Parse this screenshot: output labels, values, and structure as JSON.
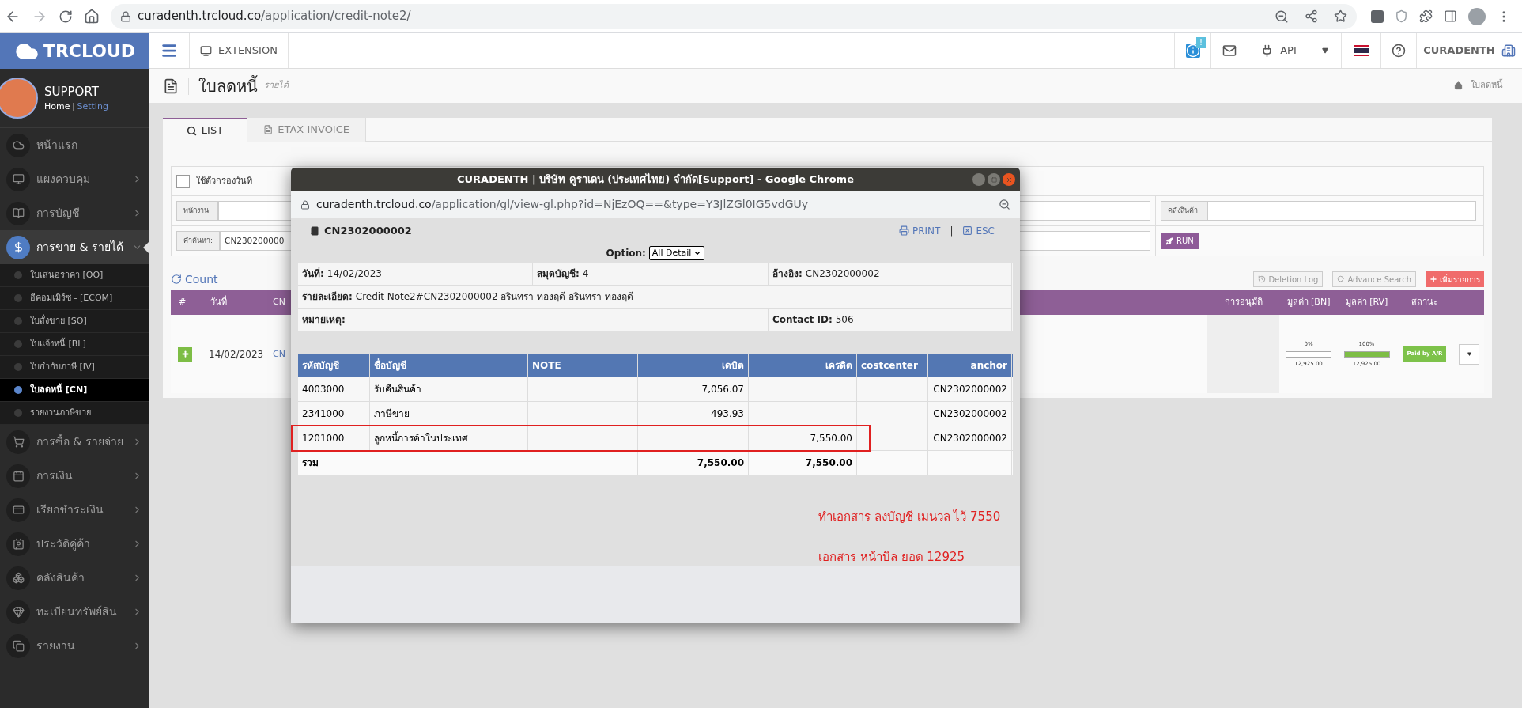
{
  "browser": {
    "url_host": "curadenth.trcloud.co",
    "url_path": "/application/credit-note2/"
  },
  "app_header": {
    "logo": "TRCLOUD",
    "extension": "EXTENSION",
    "notification_badge": "!",
    "api": "API",
    "company": "CURADENTH"
  },
  "user": {
    "name": "SUPPORT",
    "links": [
      "Home",
      "Setting"
    ]
  },
  "sidebar": {
    "items": [
      {
        "label": "หน้าแรก",
        "kind": "link",
        "selected": false
      },
      {
        "label": "แผงควบคุม",
        "kind": "group",
        "expanded": false,
        "selected": false
      },
      {
        "label": "การบัญชี",
        "kind": "group",
        "expanded": false,
        "selected": false
      },
      {
        "label": "การขาย & รายได้",
        "kind": "group",
        "expanded": true,
        "selected": true,
        "children": [
          {
            "label": "ใบเสนอราคา [QO]",
            "selected": false
          },
          {
            "label": "อีคอมเมิร์ซ - [ECOM]",
            "selected": false
          },
          {
            "label": "ใบสั่งขาย [SO]",
            "selected": false
          },
          {
            "label": "ใบแจ้งหนี้ [BL]",
            "selected": false
          },
          {
            "label": "ใบกำกับภาษี [IV]",
            "selected": false
          },
          {
            "label": "ใบลดหนี้ [CN]",
            "selected": true
          },
          {
            "label": "รายงานภาษีขาย",
            "selected": false
          }
        ]
      },
      {
        "label": "การซื้อ & รายจ่าย",
        "kind": "group",
        "expanded": false,
        "selected": false
      },
      {
        "label": "การเงิน",
        "kind": "group",
        "expanded": false,
        "selected": false
      },
      {
        "label": "เรียกชำระเงิน",
        "kind": "group",
        "expanded": false,
        "selected": false
      },
      {
        "label": "ประวัติคู่ค้า",
        "kind": "group",
        "expanded": false,
        "selected": false
      },
      {
        "label": "คลังสินค้า",
        "kind": "group",
        "expanded": false,
        "selected": false
      },
      {
        "label": "ทะเบียนทรัพย์สิน",
        "kind": "group",
        "expanded": false,
        "selected": false
      },
      {
        "label": "รายงาน",
        "kind": "group",
        "expanded": false,
        "selected": false
      }
    ]
  },
  "page": {
    "title": "ใบลดหนี้",
    "subtitle": "รายได้",
    "breadcrumb": "ใบลดหนี้"
  },
  "tabs": [
    {
      "label": "LIST",
      "selected": true
    },
    {
      "label": "ETAX INVOICE",
      "selected": false
    }
  ],
  "filters": {
    "date_filter": {
      "label": "ใช้ตัวกรองวันที่",
      "checked": false
    },
    "staff": {
      "label": "พนักงาน:"
    },
    "search": {
      "label": "คำค้นหา:",
      "value": "CN230200000"
    },
    "warehouse": {
      "label": "คลังสินค้า:"
    },
    "run": "RUN"
  },
  "list": {
    "count": "Count",
    "buttons": [
      "Deletion Log",
      "Advance Search",
      "เพิ่มรายการ"
    ],
    "columns_left": [
      "#",
      "วันที่",
      "CN"
    ],
    "columns_right": [
      "การอนุมัติ",
      "มูลค่า [BN]",
      "มูลค่า [RV]",
      "สถานะ"
    ],
    "rows": [
      {
        "date": "14/02/2023",
        "doc": "CN",
        "bn": {
          "percent": "0%",
          "level": 0,
          "amount": "12,925.00"
        },
        "rv": {
          "percent": "100%",
          "level": 1,
          "amount": "12,925.00"
        },
        "status": "Paid by A/R"
      }
    ]
  },
  "popup": {
    "title": "CURADENTH | บริษัท คูราเดน (ประเทศไทย) จำกัด[Support] - Google Chrome",
    "url_host": "curadenth.trcloud.co",
    "url_path": "/application/gl/view-gl.php?id=NjEzOQ==&type=Y3JlZGl0IG5vdGUy",
    "doc_no": "CN2302000002",
    "print": "PRINT",
    "separator": "|",
    "esc": "ESC",
    "option_label": "Option:",
    "option_value": "All Detail",
    "info": [
      [
        {
          "label": "วันที่:",
          "value": "14/02/2023"
        },
        {
          "label": "สมุดบัญชี:",
          "value": "4"
        },
        {
          "label": "อ้างอิง:",
          "value": "CN2302000002"
        }
      ],
      [
        {
          "label": "รายละเอียด:",
          "value": "Credit Note2#CN2302000002 อรินทรา ทองฤดี อรินทรา ทองฤดี"
        }
      ],
      [
        {
          "label": "หมายเหตุ:"
        },
        {
          "label": "Contact ID:",
          "value": "506"
        }
      ]
    ],
    "gl_table": {
      "columns": [
        "รหัสบัญชี",
        "ชื่อบัญชี",
        "NOTE",
        "เดบิต",
        "เครดิต",
        "costcenter",
        "anchor"
      ],
      "rows": [
        {
          "code": "4003000",
          "name": "รับคืนสินค้า",
          "debit": "7,056.07",
          "anchor": "CN2302000002",
          "highlighted": false
        },
        {
          "code": "2341000",
          "name": "ภาษีขาย",
          "debit": "493.93",
          "anchor": "CN2302000002",
          "highlighted": false
        },
        {
          "code": "1201000",
          "name": "ลูกหนี้การค้าในประเทศ",
          "credit": "7,550.00",
          "anchor": "CN2302000002",
          "highlighted": true
        }
      ],
      "total": {
        "label": "รวม",
        "debit": "7,550.00",
        "credit": "7,550.00"
      }
    },
    "annotations": [
      "ทำเอกสาร ลงบัญชี เมนวล ไว้ 7550",
      "เอกสาร หน้าบิล ยอด 12925"
    ]
  }
}
